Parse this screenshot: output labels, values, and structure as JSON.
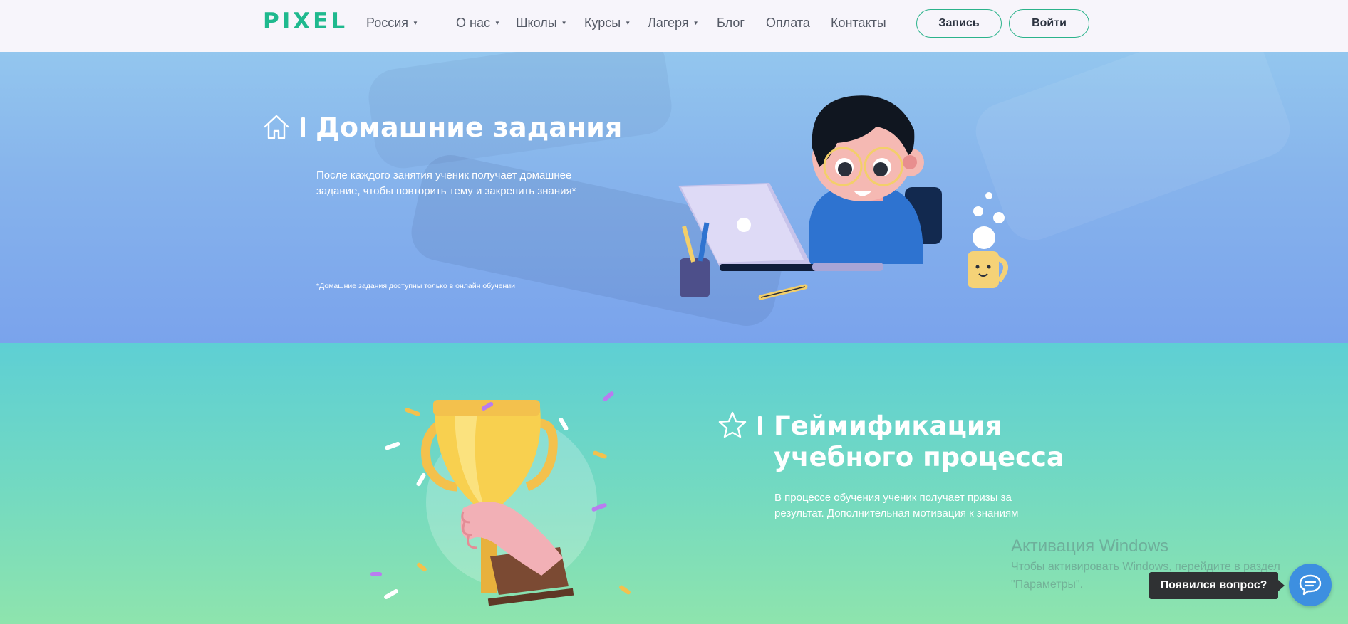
{
  "header": {
    "logo": "PIXEL",
    "region": "Россия",
    "nav": [
      {
        "label": "О нас",
        "has_dropdown": true
      },
      {
        "label": "Школы",
        "has_dropdown": true
      },
      {
        "label": "Курсы",
        "has_dropdown": true
      },
      {
        "label": "Лагеря",
        "has_dropdown": true
      },
      {
        "label": "Блог",
        "has_dropdown": false
      },
      {
        "label": "Оплата",
        "has_dropdown": false
      },
      {
        "label": "Контакты",
        "has_dropdown": false
      }
    ],
    "signup_label": "Запись",
    "login_label": "Войти"
  },
  "homework": {
    "title": "Домашние задания",
    "text": "После каждого занятия ученик получает домашнее задание, чтобы повторить тему и закрепить знания*",
    "footnote": "*Домашние задания доступны только в онлайн обучении",
    "icon": "home-icon"
  },
  "gamification": {
    "title_line1": "Геймификация",
    "title_line2": "учебного процесса",
    "text": "В процессе обучения ученик получает призы за результат. Дополнительная мотивация к знаниям",
    "icon": "star-icon"
  },
  "windows_watermark": {
    "title": "Активация Windows",
    "line1": "Чтобы активировать Windows, перейдите в раздел",
    "line2": "\"Параметры\"."
  },
  "chat": {
    "bubble": "Появился вопрос?",
    "icon": "chat-icon"
  },
  "colors": {
    "brand": "#1fb98e",
    "button_border": "#2bb38b",
    "homework_bg": "#86b3ec",
    "gamification_bg": "#72d9c2",
    "chat_button": "#3d8fe0"
  }
}
